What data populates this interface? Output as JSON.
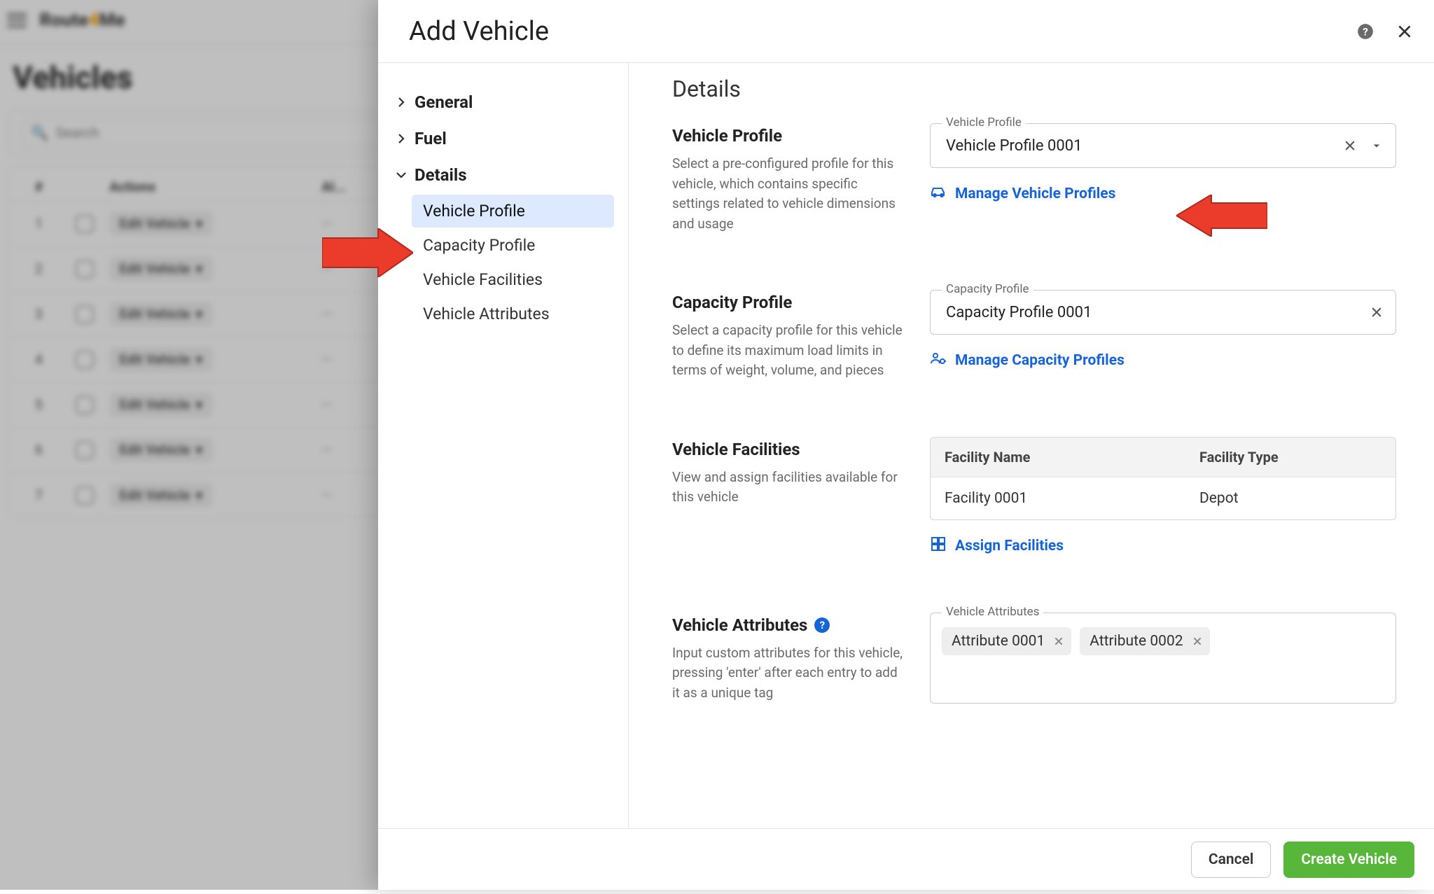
{
  "backdrop": {
    "brand1": "Route",
    "brand2": "4",
    "brand3": "Me",
    "page_title": "Vehicles",
    "search_placeholder": "Search",
    "col_actions": "Actions",
    "col_alias": "Al...",
    "row_action": "Edit Vehicle",
    "row_count": 7
  },
  "modal": {
    "title": "Add Vehicle",
    "nav": {
      "general": "General",
      "fuel": "Fuel",
      "details": "Details",
      "vehicle_profile": "Vehicle Profile",
      "capacity_profile": "Capacity Profile",
      "vehicle_facilities": "Vehicle Facilities",
      "vehicle_attributes": "Vehicle Attributes"
    },
    "section_title": "Details",
    "vehicle_profile": {
      "title": "Vehicle Profile",
      "desc": "Select a pre-configured profile for this vehicle, which contains specific settings related to vehicle dimensions and usage",
      "legend": "Vehicle Profile",
      "value": "Vehicle Profile 0001",
      "link": "Manage Vehicle Profiles"
    },
    "capacity_profile": {
      "title": "Capacity Profile",
      "desc": "Select a capacity profile for this vehicle to define its maximum load limits in terms of weight, volume, and pieces",
      "legend": "Capacity Profile",
      "value": "Capacity Profile 0001",
      "link": "Manage Capacity Profiles"
    },
    "facilities": {
      "title": "Vehicle Facilities",
      "desc": "View and assign facilities available for this vehicle",
      "col_name": "Facility Name",
      "col_type": "Facility Type",
      "row_name": "Facility 0001",
      "row_type": "Depot",
      "link": "Assign Facilities"
    },
    "attributes": {
      "title": "Vehicle Attributes",
      "desc": "Input custom attributes for this vehicle, pressing 'enter' after each entry to add it as a unique tag",
      "legend": "Vehicle Attributes",
      "tags": [
        "Attribute 0001",
        "Attribute 0002"
      ]
    },
    "footer": {
      "cancel": "Cancel",
      "create": "Create Vehicle"
    }
  }
}
